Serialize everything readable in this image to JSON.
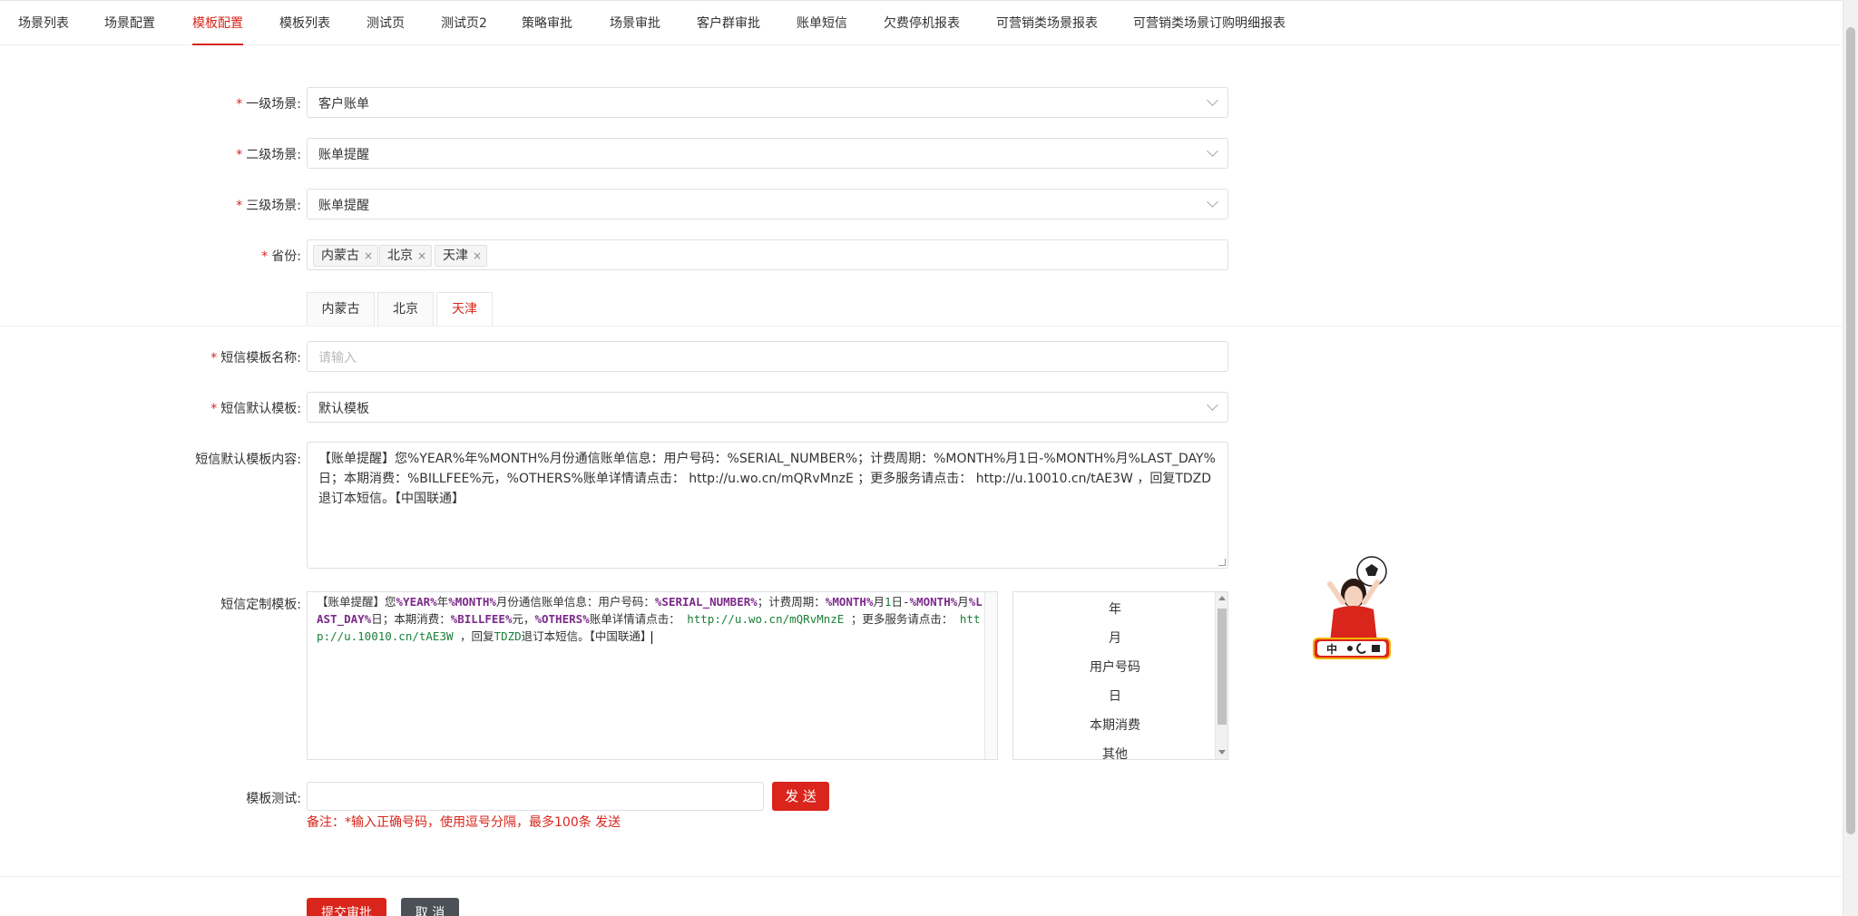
{
  "nav": {
    "tabs": [
      {
        "label": "场景列表"
      },
      {
        "label": "场景配置"
      },
      {
        "label": "模板配置",
        "active": true
      },
      {
        "label": "模板列表"
      },
      {
        "label": "测试页"
      },
      {
        "label": "测试页2"
      },
      {
        "label": "策略审批"
      },
      {
        "label": "场景审批"
      },
      {
        "label": "客户群审批"
      },
      {
        "label": "账单短信"
      },
      {
        "label": "欠费停机报表"
      },
      {
        "label": "可营销类场景报表"
      },
      {
        "label": "可营销类场景订购明细报表"
      }
    ],
    "accent_color": "#d9251c"
  },
  "form": {
    "scene1": {
      "label": "一级场景:",
      "value": "客户账单",
      "required": true
    },
    "scene2": {
      "label": "二级场景:",
      "value": "账单提醒",
      "required": true
    },
    "scene3": {
      "label": "三级场景:",
      "value": "账单提醒",
      "required": true
    },
    "province": {
      "label": "省份:",
      "required": true,
      "tags": [
        "内蒙古",
        "北京",
        "天津"
      ],
      "remove_glyph": "×"
    },
    "province_tabs": [
      {
        "label": "内蒙古"
      },
      {
        "label": "北京"
      },
      {
        "label": "天津",
        "active": true
      }
    ],
    "sms_name": {
      "label": "短信模板名称:",
      "placeholder": "请输入",
      "required": true
    },
    "sms_default": {
      "label": "短信默认模板:",
      "value": "默认模板",
      "required": true
    },
    "sms_default_content": {
      "label": "短信默认模板内容:",
      "value": "【账单提醒】您%YEAR%年%MONTH%月份通信账单信息：用户号码：%SERIAL_NUMBER%；计费周期：%MONTH%月1日-%MONTH%月%LAST_DAY%日；本期消费：%BILLFEE%元，%OTHERS%账单详情请点击： http://u.wo.cn/mQRvMnzE ；更多服务请点击：   http://u.10010.cn/tAE3W ，回复TDZD退订本短信。【中国联通】"
    },
    "custom_template": {
      "label": "短信定制模板:",
      "segments": [
        {
          "t": "【账单提醒】您"
        },
        {
          "t": "%YEAR%",
          "c": "var"
        },
        {
          "t": "年"
        },
        {
          "t": "%MONTH%",
          "c": "var"
        },
        {
          "t": "月份通信账单信息：用户号码："
        },
        {
          "t": "%SERIAL_NUMBER%",
          "c": "var"
        },
        {
          "t": "；计费周期："
        },
        {
          "t": "%MONTH%",
          "c": "var"
        },
        {
          "t": "月"
        },
        {
          "t": "1",
          "c": "num"
        },
        {
          "t": "日-"
        },
        {
          "t": "%MONTH%",
          "c": "var"
        },
        {
          "t": "月"
        },
        {
          "t": "%LAST_DAY%",
          "c": "var"
        },
        {
          "t": "日；本期消费："
        },
        {
          "t": "%BILLFEE%",
          "c": "var"
        },
        {
          "t": "元，"
        },
        {
          "t": "%OTHERS%",
          "c": "var"
        },
        {
          "t": "账单详情请点击： "
        },
        {
          "t": "http://u.wo.cn/mQRvMnzE",
          "c": "url"
        },
        {
          "t": " ；更多服务请点击：   "
        },
        {
          "t": "http://u.10010.cn/tAE3W",
          "c": "url"
        },
        {
          "t": " ，回复"
        },
        {
          "t": "TDZD",
          "c": "url"
        },
        {
          "t": "退订本短信。【中国联通】"
        }
      ],
      "variables": [
        "年",
        "月",
        "用户号码",
        "日",
        "本期消费",
        "其他"
      ]
    },
    "test": {
      "label": "模板测试:",
      "send_label": "发 送",
      "note": "备注：*输入正确号码，使用逗号分隔，最多100条 发送"
    },
    "submit_label": "提交审批",
    "cancel_label": "取 消"
  },
  "mascot": {
    "badge_text": "中",
    "icon": "mascot-with-soccer-ball"
  }
}
